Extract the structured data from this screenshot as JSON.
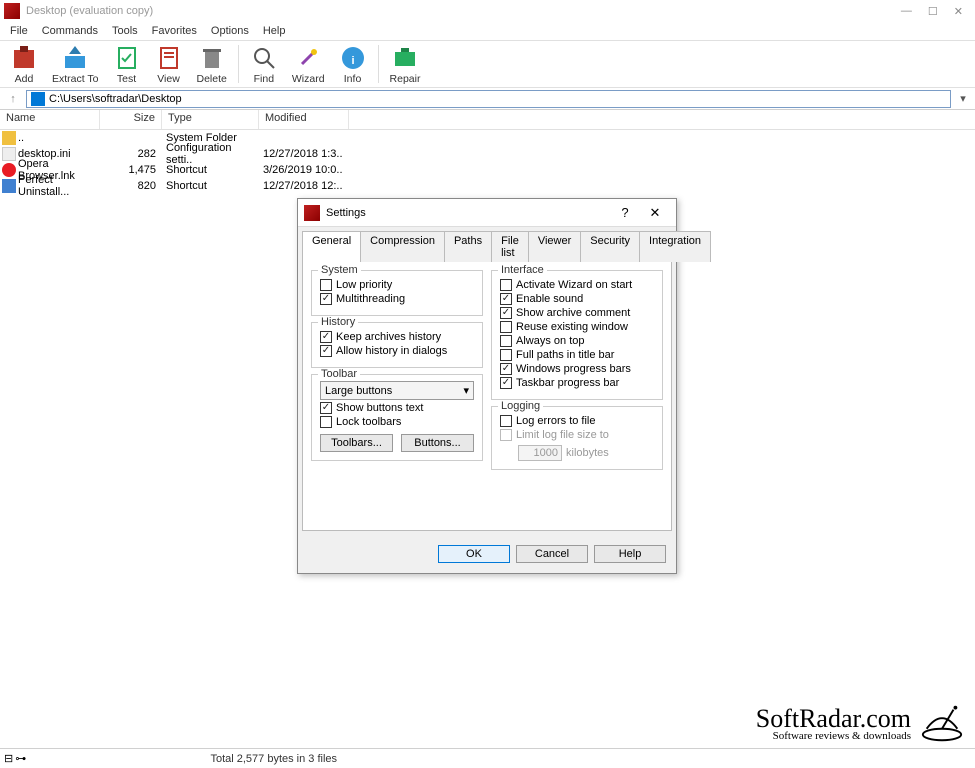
{
  "window": {
    "title": "Desktop (evaluation copy)"
  },
  "menu": [
    "File",
    "Commands",
    "Tools",
    "Favorites",
    "Options",
    "Help"
  ],
  "toolbar": [
    {
      "id": "add",
      "label": "Add"
    },
    {
      "id": "extract",
      "label": "Extract To"
    },
    {
      "id": "test",
      "label": "Test"
    },
    {
      "id": "view",
      "label": "View"
    },
    {
      "id": "delete",
      "label": "Delete"
    },
    {
      "id": "find",
      "label": "Find"
    },
    {
      "id": "wizard",
      "label": "Wizard"
    },
    {
      "id": "info",
      "label": "Info"
    },
    {
      "id": "repair",
      "label": "Repair"
    }
  ],
  "address": "C:\\Users\\softradar\\Desktop",
  "columns": {
    "name": "Name",
    "size": "Size",
    "type": "Type",
    "modified": "Modified"
  },
  "files": [
    {
      "name": "..",
      "size": "",
      "type": "System Folder",
      "modified": "",
      "icon": "fold"
    },
    {
      "name": "desktop.ini",
      "size": "282",
      "type": "Configuration setti..",
      "modified": "12/27/2018 1:3..",
      "icon": "ini"
    },
    {
      "name": "Opera Browser.lnk",
      "size": "1,475",
      "type": "Shortcut",
      "modified": "3/26/2019 10:0..",
      "icon": "opera"
    },
    {
      "name": "Perfect Uninstall...",
      "size": "820",
      "type": "Shortcut",
      "modified": "12/27/2018 12:..",
      "icon": "pu"
    }
  ],
  "dialog": {
    "title": "Settings",
    "tabs": [
      "General",
      "Compression",
      "Paths",
      "File list",
      "Viewer",
      "Security",
      "Integration"
    ],
    "active_tab": "General",
    "system": {
      "title": "System",
      "low_priority": {
        "label": "Low priority",
        "checked": false
      },
      "multithreading": {
        "label": "Multithreading",
        "checked": true
      }
    },
    "history": {
      "title": "History",
      "keep": {
        "label": "Keep archives history",
        "checked": true
      },
      "allow": {
        "label": "Allow history in dialogs",
        "checked": true
      }
    },
    "toolbar_grp": {
      "title": "Toolbar",
      "select": "Large buttons",
      "show_text": {
        "label": "Show buttons text",
        "checked": true
      },
      "lock": {
        "label": "Lock toolbars",
        "checked": false
      },
      "btn_toolbars": "Toolbars...",
      "btn_buttons": "Buttons..."
    },
    "interface": {
      "title": "Interface",
      "items": [
        {
          "label": "Activate Wizard on start",
          "checked": false
        },
        {
          "label": "Enable sound",
          "checked": true
        },
        {
          "label": "Show archive comment",
          "checked": true
        },
        {
          "label": "Reuse existing window",
          "checked": false
        },
        {
          "label": "Always on top",
          "checked": false
        },
        {
          "label": "Full paths in title bar",
          "checked": false
        },
        {
          "label": "Windows progress bars",
          "checked": true
        },
        {
          "label": "Taskbar progress bar",
          "checked": true
        }
      ]
    },
    "logging": {
      "title": "Logging",
      "log_errors": {
        "label": "Log errors to file",
        "checked": false
      },
      "limit": {
        "label": "Limit log file size to",
        "checked": false
      },
      "value": "1000",
      "unit": "kilobytes"
    },
    "buttons": {
      "ok": "OK",
      "cancel": "Cancel",
      "help": "Help"
    }
  },
  "status": "Total 2,577 bytes in 3 files",
  "watermark": {
    "brand": "SoftRadar.com",
    "sub": "Software reviews & downloads"
  }
}
